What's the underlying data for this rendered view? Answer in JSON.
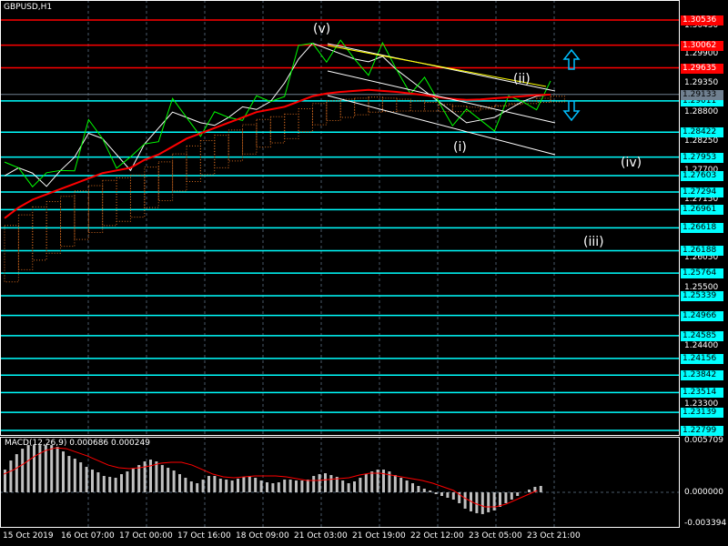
{
  "symbol_title": "GBPUSD,H1",
  "macd": {
    "title": "MACD(12,26,9) 0.000686 0.000249",
    "axis": [
      "0.005709",
      "0.000000",
      "-0.003394"
    ],
    "max": 0.005709,
    "min": -0.003394,
    "histogram": [
      0.0025,
      0.0035,
      0.0042,
      0.0048,
      0.0052,
      0.0052,
      0.0052,
      0.0052,
      0.0052,
      0.005,
      0.0045,
      0.004,
      0.0037,
      0.0033,
      0.0028,
      0.0025,
      0.0022,
      0.0018,
      0.0017,
      0.0016,
      0.002,
      0.0023,
      0.0026,
      0.003,
      0.0034,
      0.0036,
      0.0034,
      0.003,
      0.0027,
      0.0024,
      0.002,
      0.0016,
      0.0012,
      0.001,
      0.0014,
      0.0018,
      0.0018,
      0.0015,
      0.0014,
      0.0013,
      0.0015,
      0.0017,
      0.0018,
      0.0016,
      0.0013,
      0.0011,
      0.001,
      0.0011,
      0.0014,
      0.0014,
      0.0013,
      0.0013,
      0.0014,
      0.0018,
      0.002,
      0.0021,
      0.0019,
      0.0017,
      0.0013,
      0.001,
      0.0012,
      0.0016,
      0.002,
      0.0023,
      0.0025,
      0.0025,
      0.0023,
      0.0019,
      0.0016,
      0.0013,
      0.001,
      0.0007,
      0.0004,
      0.0002,
      -0.0002,
      -0.0004,
      -0.0006,
      -0.0008,
      -0.0012,
      -0.0018,
      -0.0021,
      -0.0023,
      -0.0024,
      -0.0022,
      -0.002,
      -0.0016,
      -0.0012,
      -0.0008,
      -0.0004,
      0,
      0.0003,
      0.0006,
      0.0007
    ],
    "signal": [
      0.002,
      0.0025,
      0.0032,
      0.004,
      0.0046,
      0.0049,
      0.0048,
      0.0044,
      0.004,
      0.0035,
      0.003,
      0.0027,
      0.0026,
      0.0027,
      0.0029,
      0.0032,
      0.0033,
      0.0033,
      0.003,
      0.0025,
      0.002,
      0.0017,
      0.0016,
      0.0017,
      0.0018,
      0.0018,
      0.0018,
      0.0017,
      0.0015,
      0.0013,
      0.0013,
      0.0014,
      0.0015,
      0.0016,
      0.0019,
      0.0021,
      0.0021,
      0.0019,
      0.0017,
      0.0015,
      0.0013,
      0.001,
      0.0006,
      0.0002,
      -0.0006,
      -0.0012,
      -0.0016,
      -0.0016,
      -0.0013,
      -0.0008,
      -0.0003,
      0.0002
    ]
  },
  "price": {
    "max": 1.30536,
    "min": 1.22799,
    "closes": [
      1.276,
      1.2775,
      1.2765,
      1.274,
      1.277,
      1.2795,
      1.284,
      1.283,
      1.28,
      1.277,
      1.282,
      1.285,
      1.288,
      1.287,
      1.286,
      1.2855,
      1.287,
      1.289,
      1.2885,
      1.29,
      1.2935,
      1.298,
      1.301,
      1.3,
      1.299,
      1.298,
      1.2975,
      1.2985,
      1.296,
      1.294,
      1.292,
      1.29,
      1.288,
      1.286,
      1.2865,
      1.287,
      1.2885,
      1.29,
      1.291,
      1.2913
    ],
    "ma_red": [
      1.268,
      1.27,
      1.2715,
      1.2725,
      1.2735,
      1.2745,
      1.2755,
      1.2765,
      1.277,
      1.2775,
      1.279,
      1.28,
      1.2815,
      1.283,
      1.284,
      1.285,
      1.286,
      1.287,
      1.288,
      1.2885,
      1.289,
      1.29,
      1.291,
      1.2915,
      1.2918,
      1.292,
      1.2922,
      1.292,
      1.2918,
      1.2915,
      1.2912,
      1.2908,
      1.2905,
      1.2903,
      1.2904,
      1.2906,
      1.2908,
      1.291,
      1.2912,
      1.2913
    ]
  },
  "price_levels": [
    {
      "value": "1.30536",
      "color": "#ff0000"
    },
    {
      "value": "1.30062",
      "color": "#ff0000"
    },
    {
      "value": "1.29635",
      "color": "#ff0000"
    },
    {
      "value": "1.29011",
      "color": "#00ffff"
    },
    {
      "value": "1.28422",
      "color": "#00ffff"
    },
    {
      "value": "1.27953",
      "color": "#00ffff"
    },
    {
      "value": "1.27603",
      "color": "#00ffff"
    },
    {
      "value": "1.27294",
      "color": "#00ffff"
    },
    {
      "value": "1.26961",
      "color": "#00ffff"
    },
    {
      "value": "1.26618",
      "color": "#00ffff"
    },
    {
      "value": "1.26188",
      "color": "#00ffff"
    },
    {
      "value": "1.25764",
      "color": "#00ffff"
    },
    {
      "value": "1.25339",
      "color": "#00ffff"
    },
    {
      "value": "1.24966",
      "color": "#00ffff"
    },
    {
      "value": "1.24585",
      "color": "#00ffff"
    },
    {
      "value": "1.24156",
      "color": "#00ffff"
    },
    {
      "value": "1.23842",
      "color": "#00ffff"
    },
    {
      "value": "1.23514",
      "color": "#00ffff"
    },
    {
      "value": "1.23139",
      "color": "#00ffff"
    },
    {
      "value": "1.22799",
      "color": "#00ffff"
    }
  ],
  "current_price": {
    "value": "1.29133",
    "color": "#708090"
  },
  "axis_ticks": [
    "1.30430",
    "1.29900",
    "1.29350",
    "1.28800",
    "1.28250",
    "1.27700",
    "1.27150",
    "1.26050",
    "1.25500",
    "1.24400",
    "1.23300"
  ],
  "time_labels": [
    "15 Oct 2019",
    "16 Oct 07:00",
    "17 Oct 00:00",
    "17 Oct 16:00",
    "18 Oct 09:00",
    "21 Oct 03:00",
    "21 Oct 19:00",
    "22 Oct 12:00",
    "23 Oct 05:00",
    "23 Oct 21:00"
  ],
  "wave_labels": [
    "(v)",
    "(ii)",
    "(i)",
    "(iv)",
    "(iii)"
  ]
}
